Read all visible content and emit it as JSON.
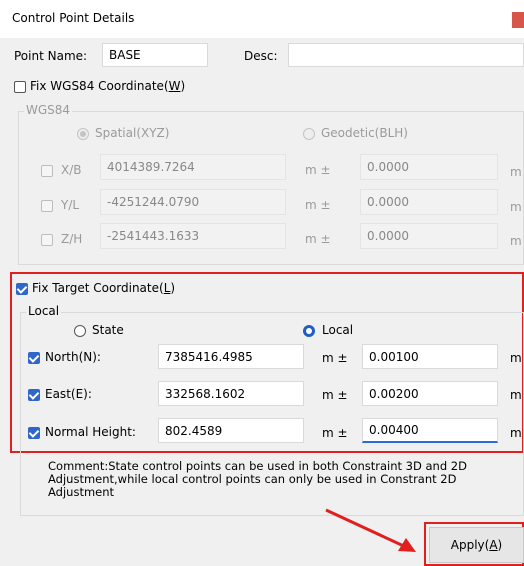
{
  "window": {
    "title": "Control Point Details"
  },
  "point": {
    "name_label": "Point Name:",
    "name_value": "BASE",
    "desc_label": "Desc:",
    "desc_value": ""
  },
  "wgs84": {
    "fix_label_pre": "Fix WGS84 Coordinate(",
    "fix_label_key": "W",
    "fix_label_post": ")",
    "fix_checked": false,
    "group_title": "WGS84",
    "spatial_label": "Spatial(XYZ)",
    "geodetic_label": "Geodetic(BLH)",
    "rows": [
      {
        "label": "X/B",
        "value": "4014389.7264",
        "unit": "m  ±",
        "precision": "0.0000",
        "unit2": "m"
      },
      {
        "label": "Y/L",
        "value": "-4251244.0790",
        "unit": "m  ±",
        "precision": "0.0000",
        "unit2": "m"
      },
      {
        "label": "Z/H",
        "value": "-2541443.1633",
        "unit": "m  ±",
        "precision": "0.0000",
        "unit2": "m"
      }
    ]
  },
  "target": {
    "fix_label_pre": "Fix Target Coordinate(",
    "fix_label_key": "L",
    "fix_label_post": ")",
    "fix_checked": true,
    "group_title": "Local",
    "state_label": "State",
    "local_label": "Local",
    "selected_mode": "Local",
    "rows": [
      {
        "label": "North(N):",
        "value": "7385416.4985",
        "unit": "m  ±",
        "precision": "0.00100",
        "unit2": "m",
        "checked": true
      },
      {
        "label": "East(E):",
        "value": "332568.1602",
        "unit": "m  ±",
        "precision": "0.00200",
        "unit2": "m",
        "checked": true
      },
      {
        "label": "Normal Height:",
        "value": "802.4589",
        "unit": "m  ±",
        "precision": "0.00400",
        "unit2": "m",
        "checked": true
      }
    ]
  },
  "comment": {
    "label": "Comment:",
    "text": "State control points can be used in both Constraint 3D and 2D Adjustment,while local control points can only be used in Constrant 2D Adjustment"
  },
  "apply": {
    "label_pre": "Apply(",
    "label_key": "A",
    "label_post": ")"
  },
  "colors": {
    "highlight": "#e0201e",
    "accent": "#2f66c9",
    "focus": "#2a6bd6"
  }
}
